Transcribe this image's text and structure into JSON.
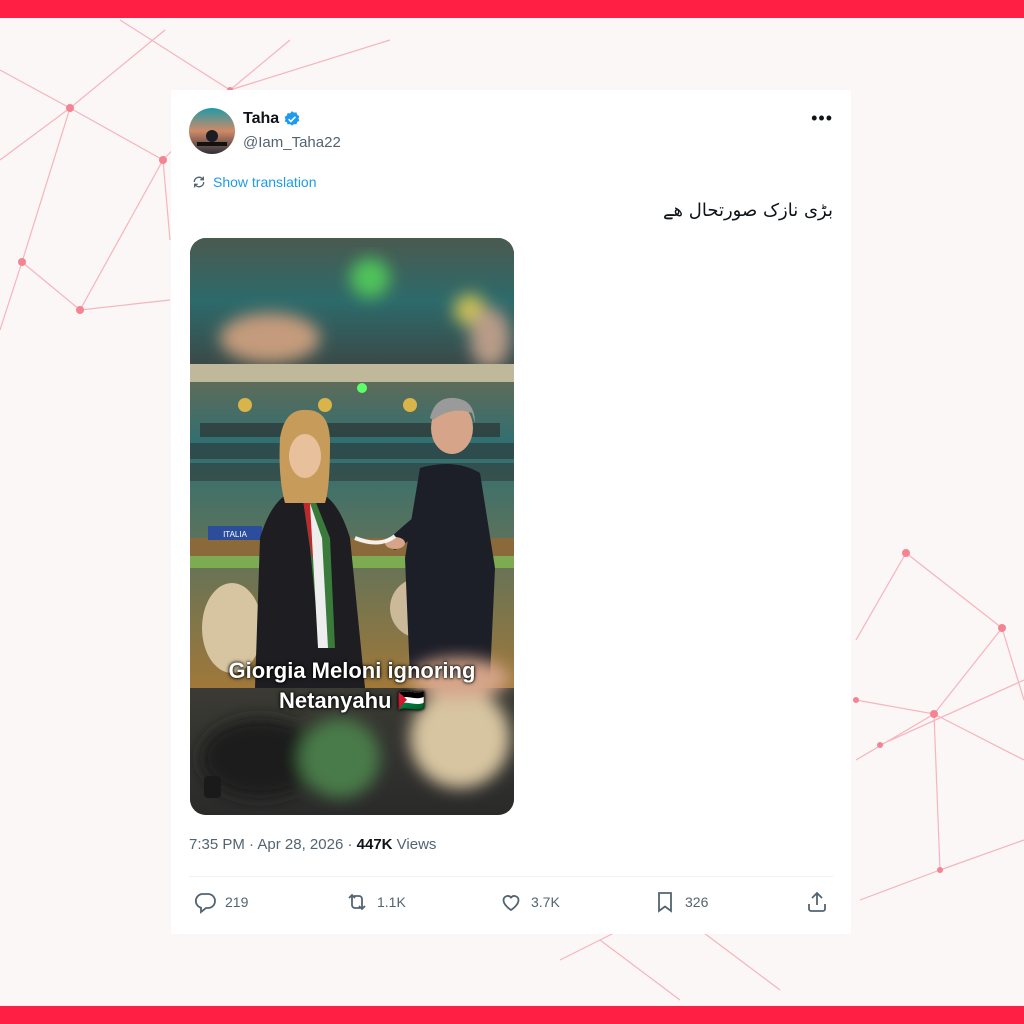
{
  "tweet": {
    "display_name": "Taha",
    "handle": "@Iam_Taha22",
    "show_translation": "Show translation",
    "text": "بڑی نازک صورتحال ھے",
    "more_icon": "more-icon",
    "verified_icon": "verified-badge-icon"
  },
  "media": {
    "caption_line1": "Giorgia Meloni ignoring",
    "caption_line2": "Netanyahu 🇵🇸",
    "desk_label": "ITALIA"
  },
  "meta": {
    "time": "7:35 PM",
    "date": "Apr 28, 2026",
    "views_count": "447K",
    "views_label": "Views"
  },
  "actions": {
    "replies": "219",
    "reposts": "1.1K",
    "likes": "3.7K",
    "bookmarks": "326"
  },
  "colors": {
    "accent": "#1d9bf0",
    "frame": "#ff1f44"
  }
}
